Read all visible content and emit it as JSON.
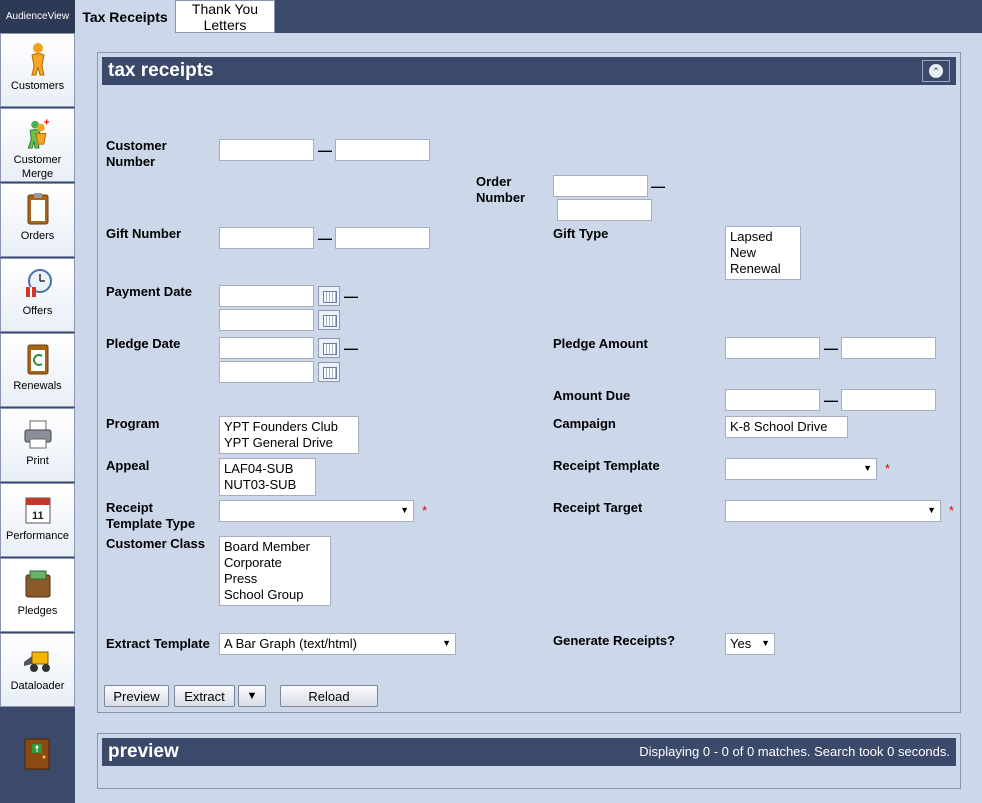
{
  "app": {
    "brand": "AudienceView"
  },
  "tabs": {
    "tax": "Tax Receipts",
    "thank_you": "Thank You Letters"
  },
  "sidebar": {
    "customers": "Customers",
    "customer_merge": "Customer Merge",
    "orders": "Orders",
    "offers": "Offers",
    "renewals": "Renewals",
    "print": "Print",
    "performance": "Performance",
    "pledges": "Pledges",
    "dataloader": "Dataloader"
  },
  "tax_panel": {
    "title": "tax receipts",
    "labels": {
      "customer_number": "Customer Number",
      "order_number": "Order Number",
      "gift_number": "Gift Number",
      "gift_type": "Gift Type",
      "payment_date": "Payment Date",
      "pledge_date": "Pledge Date",
      "pledge_amount": "Pledge Amount",
      "amount_due": "Amount Due",
      "program": "Program",
      "campaign": "Campaign",
      "appeal": "Appeal",
      "receipt_template": "Receipt Template",
      "receipt_template_type": "Receipt Template Type",
      "receipt_target": "Receipt Target",
      "customer_class": "Customer Class",
      "extract_template": "Extract Template",
      "generate_receipts": "Generate Receipts?"
    },
    "dash": "—",
    "required_mark": "*",
    "gift_type_options": [
      "Lapsed",
      "New",
      "Renewal"
    ],
    "program_options": [
      "YPT Founders Club",
      "YPT General Drive"
    ],
    "campaign_options": [
      "K-8 School Drive"
    ],
    "appeal_options": [
      "LAF04-SUB",
      "NUT03-SUB"
    ],
    "customer_class_options": [
      "Board Member",
      "Corporate",
      "Press",
      "School Group"
    ],
    "extract_template_value": "A Bar Graph (text/html)",
    "generate_receipts_value": "Yes",
    "buttons": {
      "preview": "Preview",
      "extract": "Extract",
      "extract_menu": "▼",
      "reload": "Reload"
    }
  },
  "preview_panel": {
    "title": "preview",
    "status": "Displaying 0 - 0 of 0 matches. Search took 0 seconds."
  }
}
